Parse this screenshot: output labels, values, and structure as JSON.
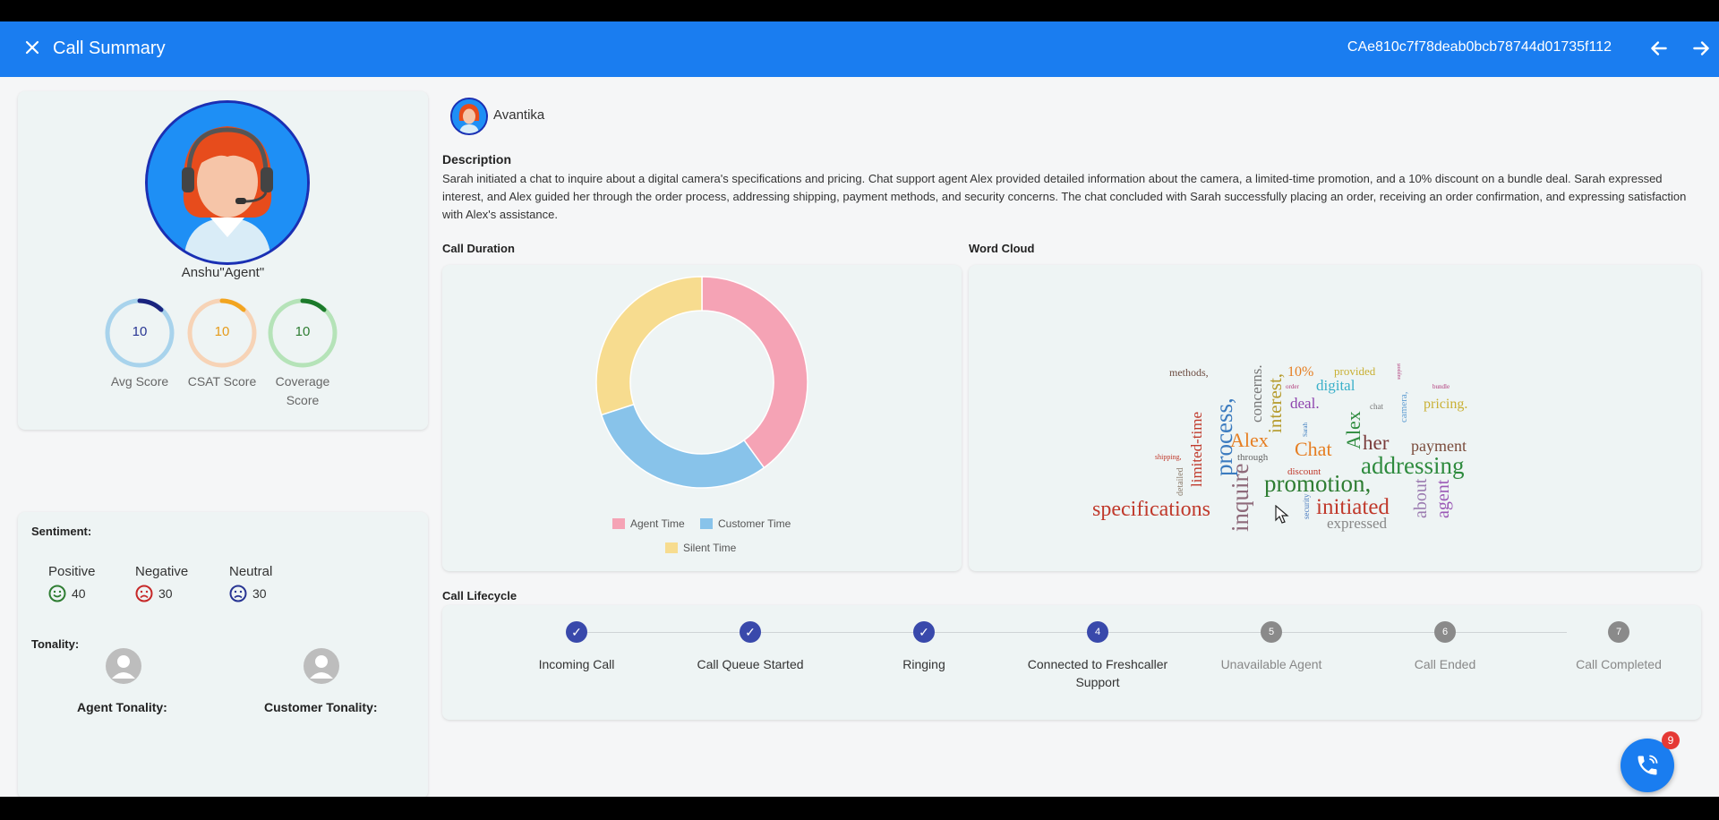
{
  "header": {
    "title": "Call Summary",
    "call_id": "CAe810c7f78deab0bcb78744d01735f112"
  },
  "agent": {
    "name": "Anshu\"Agent\"",
    "scores": [
      {
        "label": "Avg Score",
        "value": "10",
        "color": "#1a237e",
        "track": "#a8d3ec"
      },
      {
        "label": "CSAT Score",
        "value": "10",
        "color": "#f2a51f",
        "track": "#f7d3b6"
      },
      {
        "label": "Coverage Score",
        "value": "10",
        "color": "#1b7a2a",
        "track": "#b5e3b8"
      }
    ]
  },
  "sentiment": {
    "title": "Sentiment:",
    "positive": {
      "label": "Positive",
      "value": "40",
      "color": "#2e7d32"
    },
    "negative": {
      "label": "Negative",
      "value": "30",
      "color": "#c62828"
    },
    "neutral": {
      "label": "Neutral",
      "value": "30",
      "color": "#283593"
    }
  },
  "tonality": {
    "title": "Tonality:",
    "agent_label": "Agent Tonality:",
    "customer_label": "Customer Tonality:"
  },
  "customer": {
    "name": "Avantika"
  },
  "description": {
    "title": "Description",
    "text": "Sarah initiated a chat to inquire about a digital camera's specifications and pricing. Chat support agent Alex provided detailed information about the camera, a limited-time promotion, and a 10% discount on a bundle deal. Sarah expressed interest, and Alex guided her through the order process, addressing shipping, payment methods, and security concerns. The chat concluded with Sarah successfully placing an order, receiving an order confirmation, and expressing satisfaction with Alex's assistance."
  },
  "call_duration": {
    "title": "Call Duration",
    "chart_data": {
      "type": "pie",
      "variant": "doughnut",
      "categories": [
        "Agent Time",
        "Customer Time",
        "Silent Time"
      ],
      "values": [
        40,
        30,
        30
      ],
      "colors": [
        "#f5a3b5",
        "#88c3ea",
        "#f7dc8f"
      ],
      "legend": "bottom"
    }
  },
  "word_cloud": {
    "title": "Word Cloud",
    "words": [
      {
        "text": "specifications",
        "color": "#c0392b"
      },
      {
        "text": "inquire",
        "color": "#8e6a7a"
      },
      {
        "text": "promotion,",
        "color": "#2e7d32"
      },
      {
        "text": "addressing",
        "color": "#2e8b3e"
      },
      {
        "text": "initiated",
        "color": "#c0392b"
      },
      {
        "text": "process,",
        "color": "#3b7bbf"
      },
      {
        "text": "Alex",
        "color": "#e67e22"
      },
      {
        "text": "Chat",
        "color": "#e67e22"
      },
      {
        "text": "her",
        "color": "#7a3b3b"
      },
      {
        "text": "Alex",
        "color": "#2e8b3e"
      },
      {
        "text": "payment",
        "color": "#7a4b3b"
      },
      {
        "text": "interest,",
        "color": "#b59a2a"
      },
      {
        "text": "concerns.",
        "color": "#777777"
      },
      {
        "text": "limited-time",
        "color": "#c0392b"
      },
      {
        "text": "expressed",
        "color": "#888888"
      },
      {
        "text": "about",
        "color": "#9b7bb0"
      },
      {
        "text": "agent",
        "color": "#9b59b6"
      },
      {
        "text": "deal.",
        "color": "#8e44ad"
      },
      {
        "text": "digital",
        "color": "#3ab0c9"
      },
      {
        "text": "10%",
        "color": "#e67e22"
      },
      {
        "text": "provided",
        "color": "#c9b034"
      },
      {
        "text": "pricing.",
        "color": "#c9b034"
      },
      {
        "text": "methods,",
        "color": "#6d4c41"
      },
      {
        "text": "through",
        "color": "#666666"
      },
      {
        "text": "discount",
        "color": "#c0392b"
      },
      {
        "text": "detailed",
        "color": "#8a7a6a"
      },
      {
        "text": "chat",
        "color": "#777777"
      },
      {
        "text": "shipping,",
        "color": "#c0392b"
      },
      {
        "text": "security",
        "color": "#4a7bbf"
      },
      {
        "text": "camera,",
        "color": "#5c9bd1"
      },
      {
        "text": "bundle",
        "color": "#b03a7a"
      },
      {
        "text": "order",
        "color": "#b03a7a"
      },
      {
        "text": "support",
        "color": "#b03a7a"
      },
      {
        "text": "Sarah",
        "color": "#3b7bbf"
      }
    ]
  },
  "lifecycle": {
    "title": "Call Lifecycle",
    "steps": [
      {
        "label": "Incoming Call",
        "marker": "✓",
        "status": "done"
      },
      {
        "label": "Call Queue Started",
        "marker": "✓",
        "status": "done"
      },
      {
        "label": "Ringing",
        "marker": "✓",
        "status": "done"
      },
      {
        "label": "Connected to Freshcaller Support",
        "marker": "4",
        "status": "active"
      },
      {
        "label": "Unavailable Agent",
        "marker": "5",
        "status": "pending"
      },
      {
        "label": "Call Ended",
        "marker": "6",
        "status": "pending"
      },
      {
        "label": "Call Completed",
        "marker": "7",
        "status": "pending"
      }
    ]
  },
  "fab": {
    "badge": "9",
    "icon": "phone-icon"
  },
  "colors": {
    "primary": "#1a7df0",
    "step_done": "#3949ab",
    "step_pending": "#8a8a8a"
  }
}
